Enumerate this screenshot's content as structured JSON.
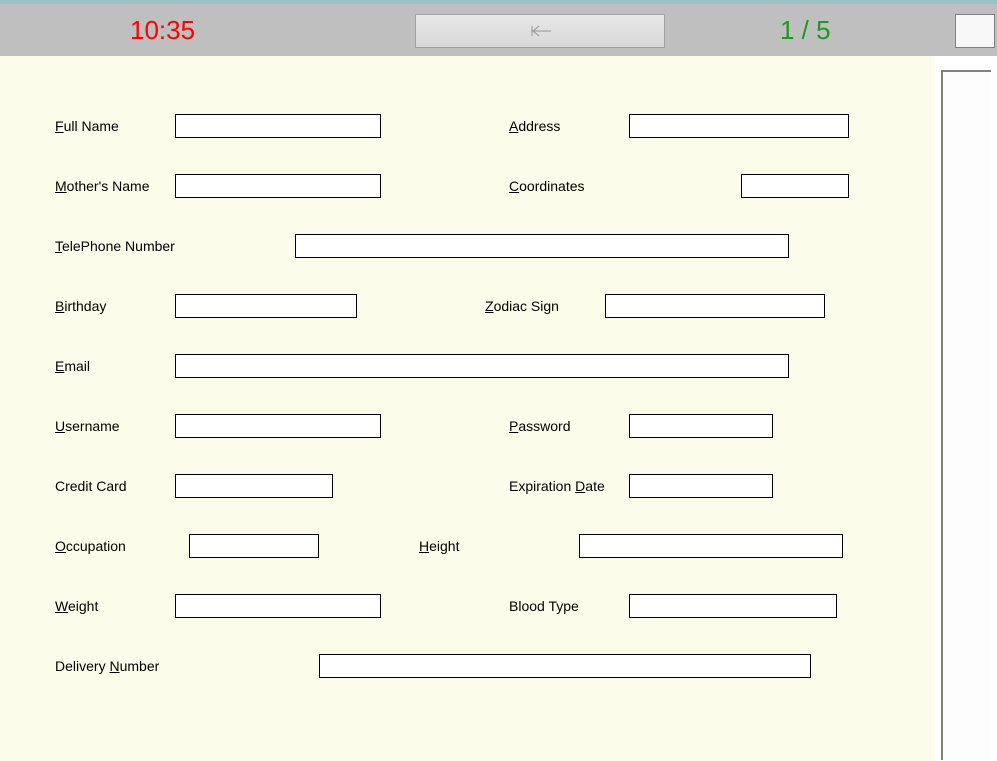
{
  "toolbar": {
    "timer": "10:35",
    "progress": "1 / 5"
  },
  "form": {
    "fullName": {
      "label_pre": "",
      "u": "F",
      "label_post": "ull Name",
      "value": ""
    },
    "address": {
      "label_pre": "",
      "u": "A",
      "label_post": "ddress",
      "value": ""
    },
    "mothersName": {
      "label_pre": "",
      "u": "M",
      "label_post": "other's Name",
      "value": ""
    },
    "coordinates": {
      "label_pre": "",
      "u": "C",
      "label_post": "oordinates",
      "value": ""
    },
    "telephone": {
      "label_pre": "",
      "u": "T",
      "label_post": "elePhone Number",
      "value": ""
    },
    "birthday": {
      "label_pre": "",
      "u": "B",
      "label_post": "irthday",
      "value": ""
    },
    "zodiac": {
      "label_pre": "",
      "u": "Z",
      "label_post": "odiac Sign",
      "value": ""
    },
    "email": {
      "label_pre": "",
      "u": "E",
      "label_post": "mail",
      "value": ""
    },
    "username": {
      "label_pre": "",
      "u": "U",
      "label_post": "sername",
      "value": ""
    },
    "password": {
      "label_pre": "",
      "u": "P",
      "label_post": "assword",
      "value": ""
    },
    "creditCard": {
      "label_plain": "Credit Card",
      "value": ""
    },
    "expiration": {
      "label_pre": "Expiration ",
      "u": "D",
      "label_post": "ate",
      "value": ""
    },
    "occupation": {
      "label_pre": "",
      "u": "O",
      "label_post": "ccupation",
      "value": ""
    },
    "height": {
      "label_pre": "",
      "u": "H",
      "label_post": "eight",
      "value": ""
    },
    "weight": {
      "label_pre": "",
      "u": "W",
      "label_post": "eight",
      "value": ""
    },
    "bloodType": {
      "label_plain": "Blood Type",
      "value": ""
    },
    "delivery": {
      "label_pre": "Delivery ",
      "u": "N",
      "label_post": "umber",
      "value": ""
    }
  }
}
